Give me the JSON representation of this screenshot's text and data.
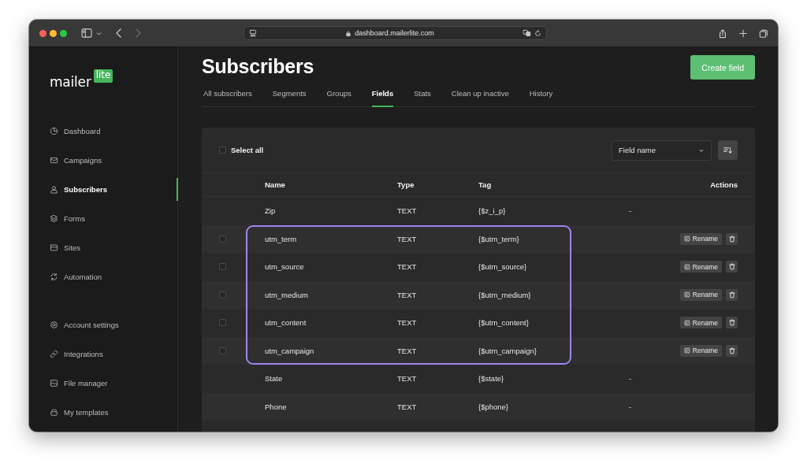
{
  "browser": {
    "url": "dashboard.mailerlite.com"
  },
  "logo": {
    "word": "mailer",
    "badge": "lite"
  },
  "sidebar": {
    "sections": [
      {
        "items": [
          {
            "label": "Dashboard",
            "selected": false
          },
          {
            "label": "Campaigns",
            "selected": false
          },
          {
            "label": "Subscribers",
            "selected": true
          },
          {
            "label": "Forms",
            "selected": false
          },
          {
            "label": "Sites",
            "selected": false
          },
          {
            "label": "Automation",
            "selected": false
          }
        ]
      },
      {
        "items": [
          {
            "label": "Account settings",
            "selected": false
          },
          {
            "label": "Integrations",
            "selected": false
          },
          {
            "label": "File manager",
            "selected": false
          },
          {
            "label": "My templates",
            "selected": false
          }
        ]
      }
    ]
  },
  "page": {
    "title": "Subscribers",
    "action": "Create field"
  },
  "tabs": [
    {
      "label": "All subscribers",
      "selected": false
    },
    {
      "label": "Segments",
      "selected": false
    },
    {
      "label": "Groups",
      "selected": false
    },
    {
      "label": "Fields",
      "selected": true
    },
    {
      "label": "Stats",
      "selected": false
    },
    {
      "label": "Clean up inactive",
      "selected": false
    },
    {
      "label": "History",
      "selected": false
    }
  ],
  "toolbar": {
    "select_all": {
      "label": "Select all",
      "checked": false
    },
    "sort": {
      "value": "Field name"
    }
  },
  "table": {
    "columns": [
      "Name",
      "Type",
      "Tag",
      "Actions"
    ],
    "rows": [
      {
        "kind": "system",
        "name": "Zip",
        "type": "TEXT",
        "tag": "{$z_i_p}",
        "actions": "-",
        "highlighted": false
      },
      {
        "kind": "custom",
        "name": "utm_term",
        "type": "TEXT",
        "tag": "{$utm_term}",
        "checked": false,
        "rename": "Rename",
        "highlighted": true
      },
      {
        "kind": "custom",
        "name": "utm_source",
        "type": "TEXT",
        "tag": "{$utm_source}",
        "checked": false,
        "rename": "Rename",
        "highlighted": true
      },
      {
        "kind": "custom",
        "name": "utm_medium",
        "type": "TEXT",
        "tag": "{$utm_medium}",
        "checked": false,
        "rename": "Rename",
        "highlighted": true
      },
      {
        "kind": "custom",
        "name": "utm_content",
        "type": "TEXT",
        "tag": "{$utm_content}",
        "checked": false,
        "rename": "Rename",
        "highlighted": true
      },
      {
        "kind": "custom",
        "name": "utm_campaign",
        "type": "TEXT",
        "tag": "{$utm_campaign}",
        "checked": false,
        "rename": "Rename",
        "highlighted": true
      },
      {
        "kind": "system",
        "name": "State",
        "type": "TEXT",
        "tag": "{$state}",
        "actions": "-",
        "highlighted": false
      },
      {
        "kind": "system",
        "name": "Phone",
        "type": "TEXT",
        "tag": "{$phone}",
        "actions": "-",
        "highlighted": false
      }
    ]
  }
}
